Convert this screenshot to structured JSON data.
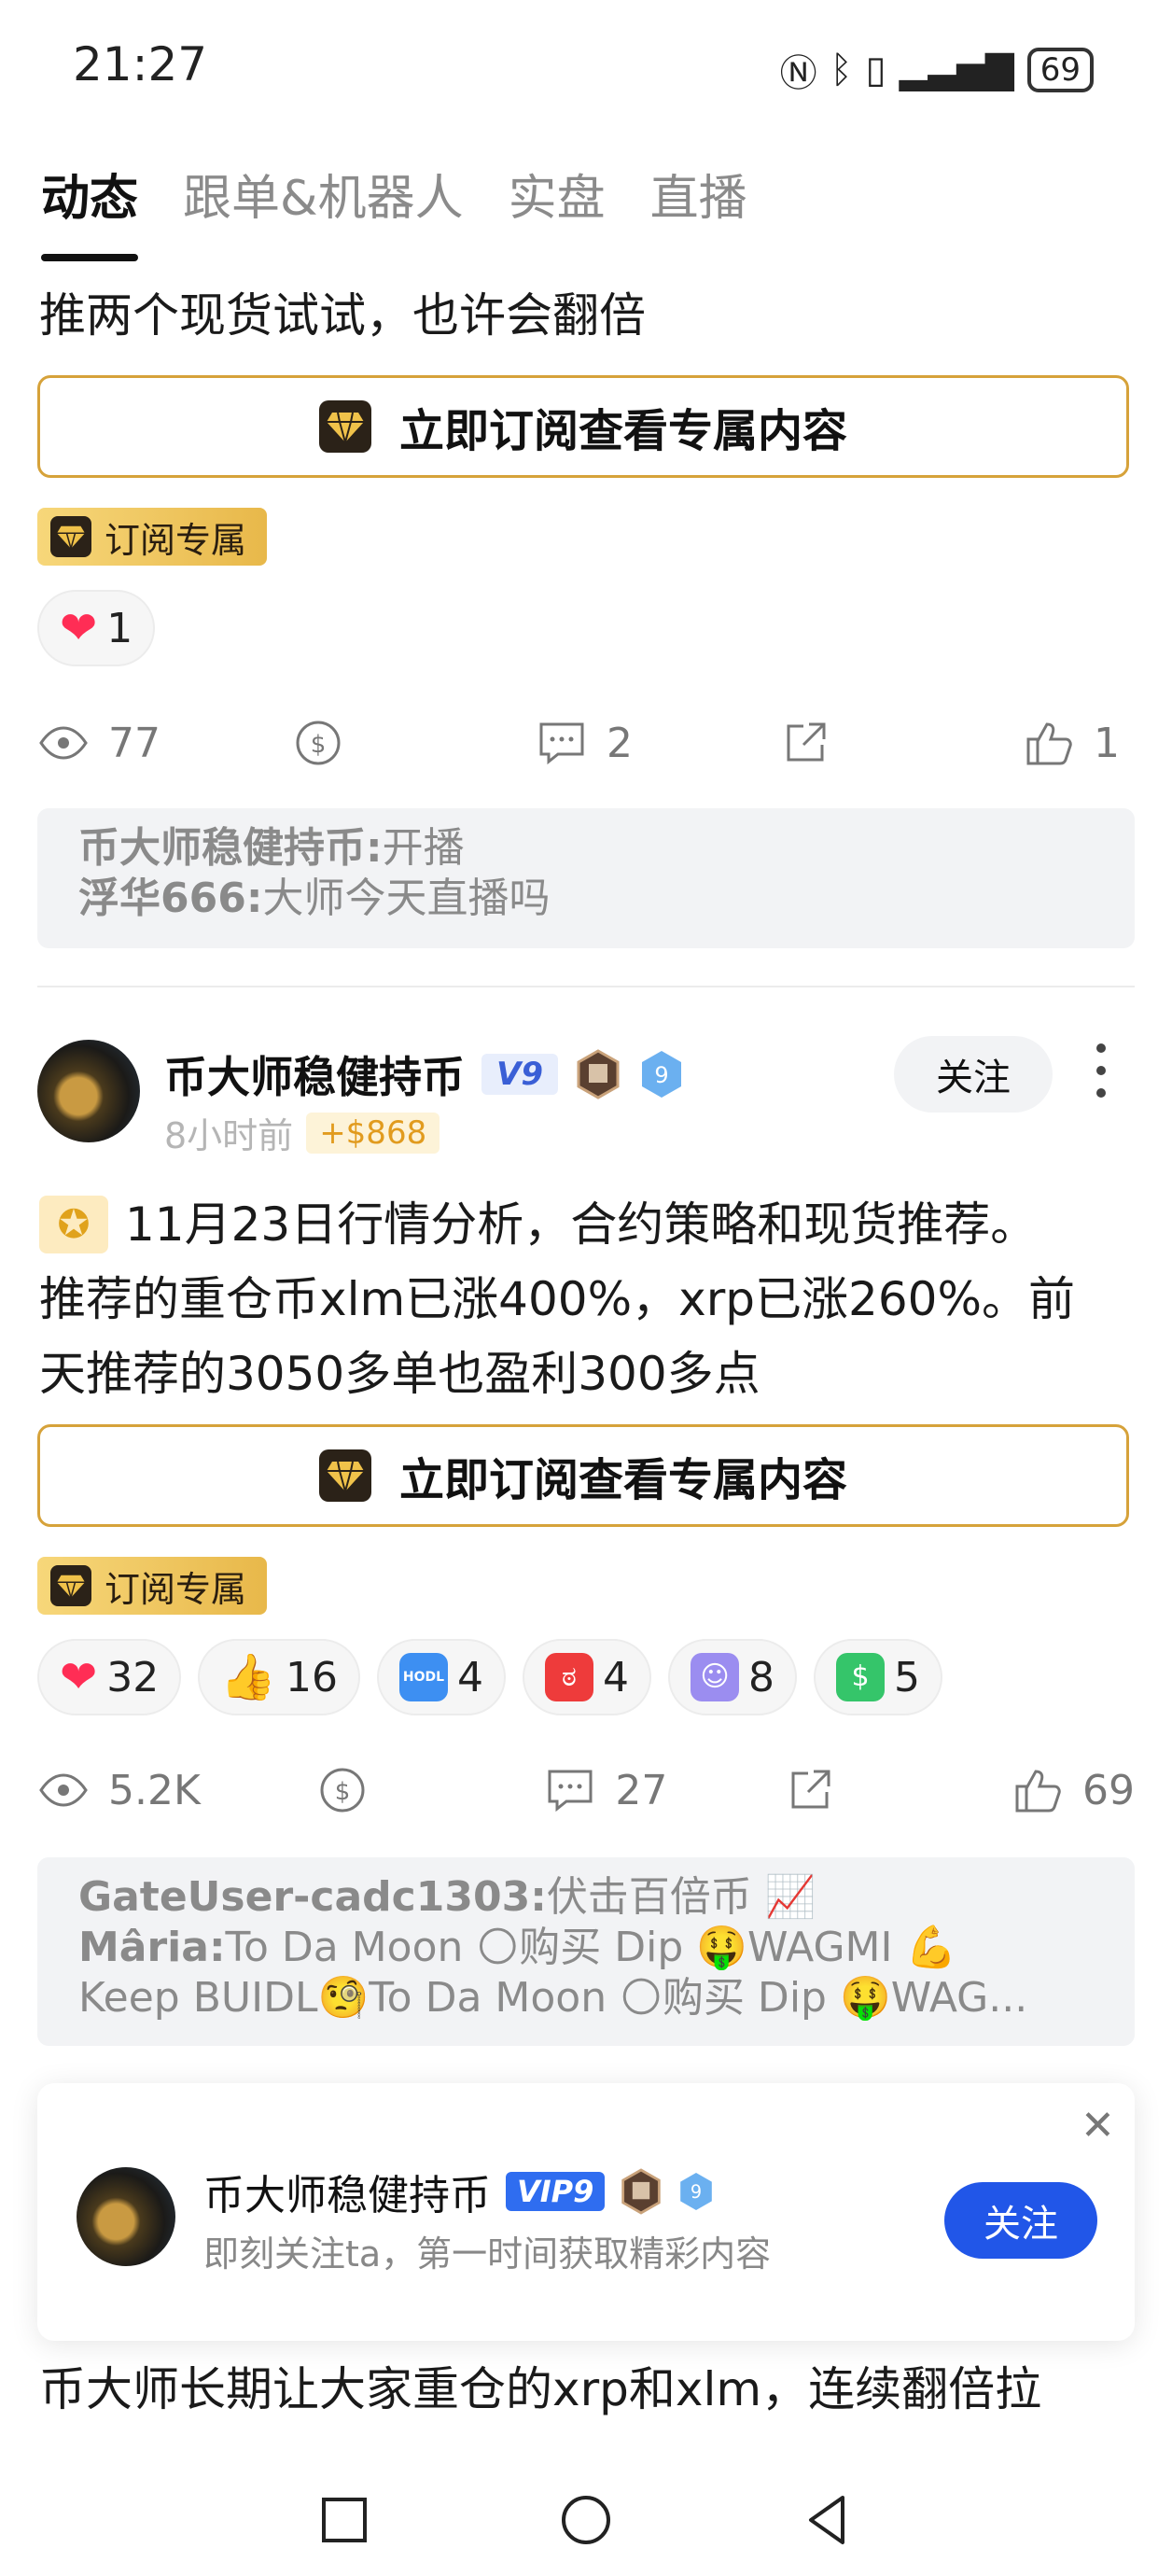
{
  "status_bar": {
    "time": "21:27",
    "battery": "69"
  },
  "tabs": [
    {
      "label": "动态",
      "active": true
    },
    {
      "label": "跟单&机器人",
      "active": false
    },
    {
      "label": "实盘",
      "active": false
    },
    {
      "label": "直播",
      "active": false
    }
  ],
  "post1": {
    "text": "推两个现货试试，也许会翻倍",
    "subscribe_button": "立即订阅查看专属内容",
    "subscribe_tag": "订阅专属",
    "reactions": [
      {
        "icon": "heart-icon",
        "count": "1"
      }
    ],
    "actions": {
      "views": "77",
      "comments": "2",
      "likes": "1"
    },
    "comments": [
      {
        "user": "币大师稳健持币:",
        "text": "开播"
      },
      {
        "user": "浮华666:",
        "text": "大师今天直播吗"
      }
    ]
  },
  "post2": {
    "author": {
      "name": "币大师稳健持币",
      "vip": "V9",
      "level": "9"
    },
    "time": "8小时前",
    "earnings": "+$868",
    "follow_label": "关注",
    "text_line1": "11月23日行情分析，合约策略和现货推荐。",
    "text_line2": "推荐的重仓币xlm已涨400%，xrp已涨260%。前",
    "text_line3": "天推荐的3050多单也盈利300多点",
    "subscribe_button": "立即订阅查看专属内容",
    "subscribe_tag": "订阅专属",
    "reactions": [
      {
        "icon": "heart-icon",
        "count": "32"
      },
      {
        "icon": "thumbs-up-icon",
        "count": "16"
      },
      {
        "icon": "hodl-icon",
        "count": "4"
      },
      {
        "icon": "angry-face-icon",
        "count": "4"
      },
      {
        "icon": "grimace-face-icon",
        "count": "8"
      },
      {
        "icon": "money-face-icon",
        "count": "5"
      }
    ],
    "actions": {
      "views": "5.2K",
      "comments": "27",
      "likes": "69"
    },
    "comments": [
      {
        "user": "GateUser-cadc1303:",
        "text": "伏击百倍币 📈"
      },
      {
        "user": "Mâria:",
        "text": "To Da Moon 🌕购买 Dip 🤑WAGMI 💪"
      },
      {
        "user": "",
        "text": "Keep BUIDL🧐To Da Moon 🌕购买 Dip 🤑WAG..."
      }
    ]
  },
  "popup": {
    "name": "币大师稳健持币",
    "vip": "VIP9",
    "level": "9",
    "subtitle": "即刻关注ta，第一时间获取精彩内容",
    "follow_label": "关注"
  },
  "post3": {
    "text": "币大师长期让大家重仓的xrp和xlm，连续翻倍拉"
  }
}
